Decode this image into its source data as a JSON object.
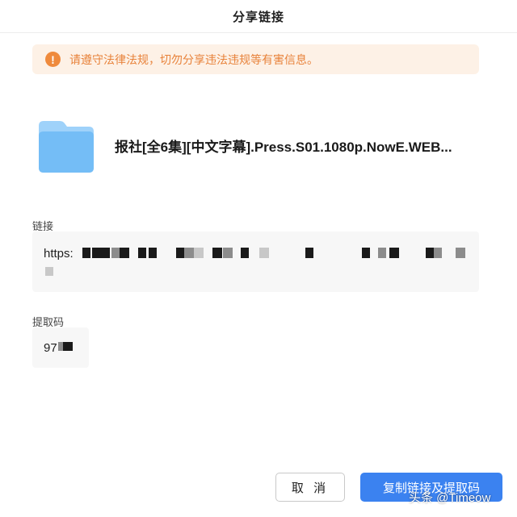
{
  "dialog": {
    "title": "分享链接"
  },
  "warning": {
    "icon": "exclamation-icon",
    "icon_glyph": "!",
    "text": "请遵守法律法规，切勿分享违法违规等有害信息。",
    "color": "#e8823a",
    "background": "#fdf1e6"
  },
  "file": {
    "icon": "folder-icon",
    "name": "报社[全6集][中文字幕].Press.S01.1080p.NowE.WEB..."
  },
  "link": {
    "label": "链接",
    "value": "https:"
  },
  "code": {
    "label": "提取码",
    "value": "97"
  },
  "buttons": {
    "cancel": "取 消",
    "copy": "复制链接及提取码"
  },
  "watermark": "头条 @Timeow",
  "colors": {
    "primary": "#3b82f0",
    "folder": "#7cc0f7"
  }
}
